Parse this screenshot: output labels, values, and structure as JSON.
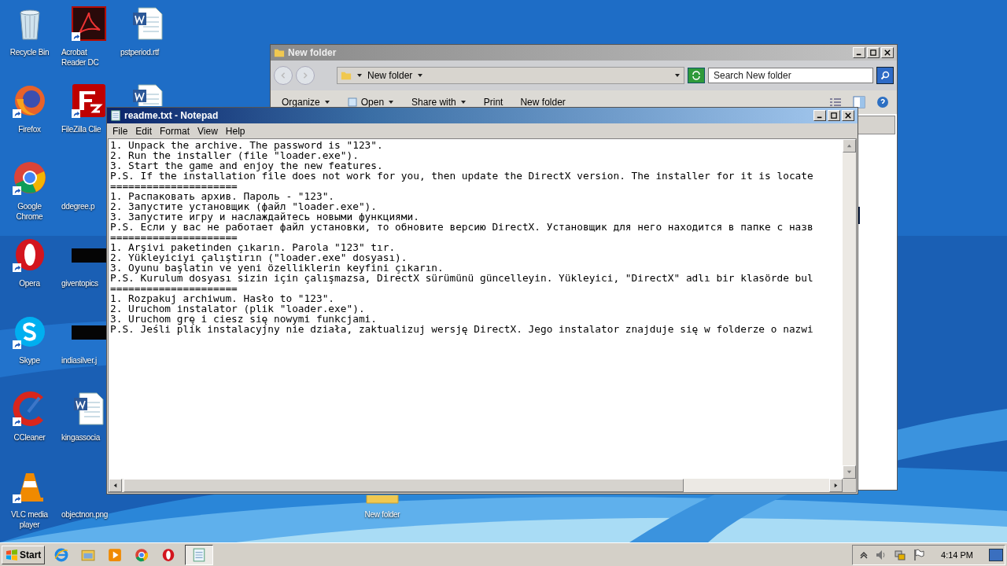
{
  "desktop_icons": [
    {
      "label": "Recycle Bin",
      "kind": "recycle",
      "shortcut": false
    },
    {
      "label": "Firefox",
      "kind": "firefox",
      "shortcut": true
    },
    {
      "label": "Google Chrome",
      "kind": "chrome",
      "shortcut": true
    },
    {
      "label": "Opera",
      "kind": "opera",
      "shortcut": true
    },
    {
      "label": "Skype",
      "kind": "skype",
      "shortcut": true
    },
    {
      "label": "CCleaner",
      "kind": "ccleaner",
      "shortcut": true
    },
    {
      "label": "VLC media player",
      "kind": "vlc",
      "shortcut": true
    },
    {
      "label": "Acrobat Reader DC",
      "kind": "acrobat",
      "shortcut": true
    },
    {
      "label": "FileZilla Clie",
      "kind": "filezilla",
      "shortcut": true
    },
    {
      "label": "ddegree.p",
      "kind": "blank",
      "shortcut": false
    },
    {
      "label": "giventopics",
      "kind": "image-dark",
      "shortcut": false
    },
    {
      "label": "indiasilver.j",
      "kind": "image-dark",
      "shortcut": false
    },
    {
      "label": "kingassocia",
      "kind": "word",
      "shortcut": false
    },
    {
      "label": "objectnon.png",
      "kind": "blank",
      "shortcut": false
    },
    {
      "label": "pstperiod.rtf",
      "kind": "word",
      "shortcut": false
    },
    {
      "kind": "word",
      "shortcut": false
    }
  ],
  "loose_icon": {
    "label": "New folder",
    "kind": "folder"
  },
  "explorer": {
    "title": "New folder",
    "address": "New folder",
    "search": {
      "placeholder": "Search New folder"
    },
    "toolbar": [
      {
        "label": "Organize",
        "dropdown": true,
        "icon": false
      },
      {
        "label": "Open",
        "dropdown": true,
        "icon": true
      },
      {
        "label": "Share with",
        "dropdown": true,
        "icon": false
      },
      {
        "label": "Print",
        "dropdown": false,
        "icon": false
      },
      {
        "label": "New folder",
        "dropdown": false,
        "icon": false
      }
    ]
  },
  "notepad": {
    "title": "readme.txt - Notepad",
    "menu": [
      "File",
      "Edit",
      "Format",
      "View",
      "Help"
    ],
    "lines": [
      "1. Unpack the archive. The password is \"123\".",
      "2. Run the installer (file \"loader.exe\").",
      "3. Start the game and enjoy the new features.",
      "P.S. If the installation file does not work for you, then update the DirectX version. The installer for it is locate",
      "=====================",
      "1. Распаковать архив. Пароль - \"123\".",
      "2. Запустите установщик (файл \"loader.exe\").",
      "3. Запустите игру и наслаждайтесь новыми функциями.",
      "P.S. Если у вас не работает файл установки, то обновите версию DirectX. Установщик для него находится в папке с назв",
      "=====================",
      "1. Arşivi paketinden çıkarın. Parola \"123\" tır.",
      "2. Yükleyiciyi çalıştırın (\"loader.exe\" dosyası).",
      "3. Oyunu başlatın ve yeni özelliklerin keyfini çıkarın.",
      "P.S. Kurulum dosyası sizin için çalışmazsa, DirectX sürümünü güncelleyin. Yükleyici, \"DirectX\" adlı bir klasörde bul",
      "=====================",
      "1. Rozpakuj archiwum. Hasło to \"123\".",
      "2. Uruchom instalator (plik \"loader.exe\").",
      "3. Uruchom grę i ciesz się nowymi funkcjami.",
      "P.S. Jeśli plik instalacyjny nie działa, zaktualizuj wersję DirectX. Jego instalator znajduje się w folderze o nazwi"
    ]
  },
  "taskbar": {
    "start": "Start",
    "apps": [
      {
        "kind": "ie",
        "selected": false
      },
      {
        "kind": "explorer",
        "selected": false
      },
      {
        "kind": "media",
        "selected": false
      },
      {
        "kind": "chrome",
        "selected": false
      },
      {
        "kind": "opera",
        "selected": false
      },
      {
        "kind": "notepad",
        "selected": true
      }
    ],
    "clock": "4:14 PM"
  }
}
